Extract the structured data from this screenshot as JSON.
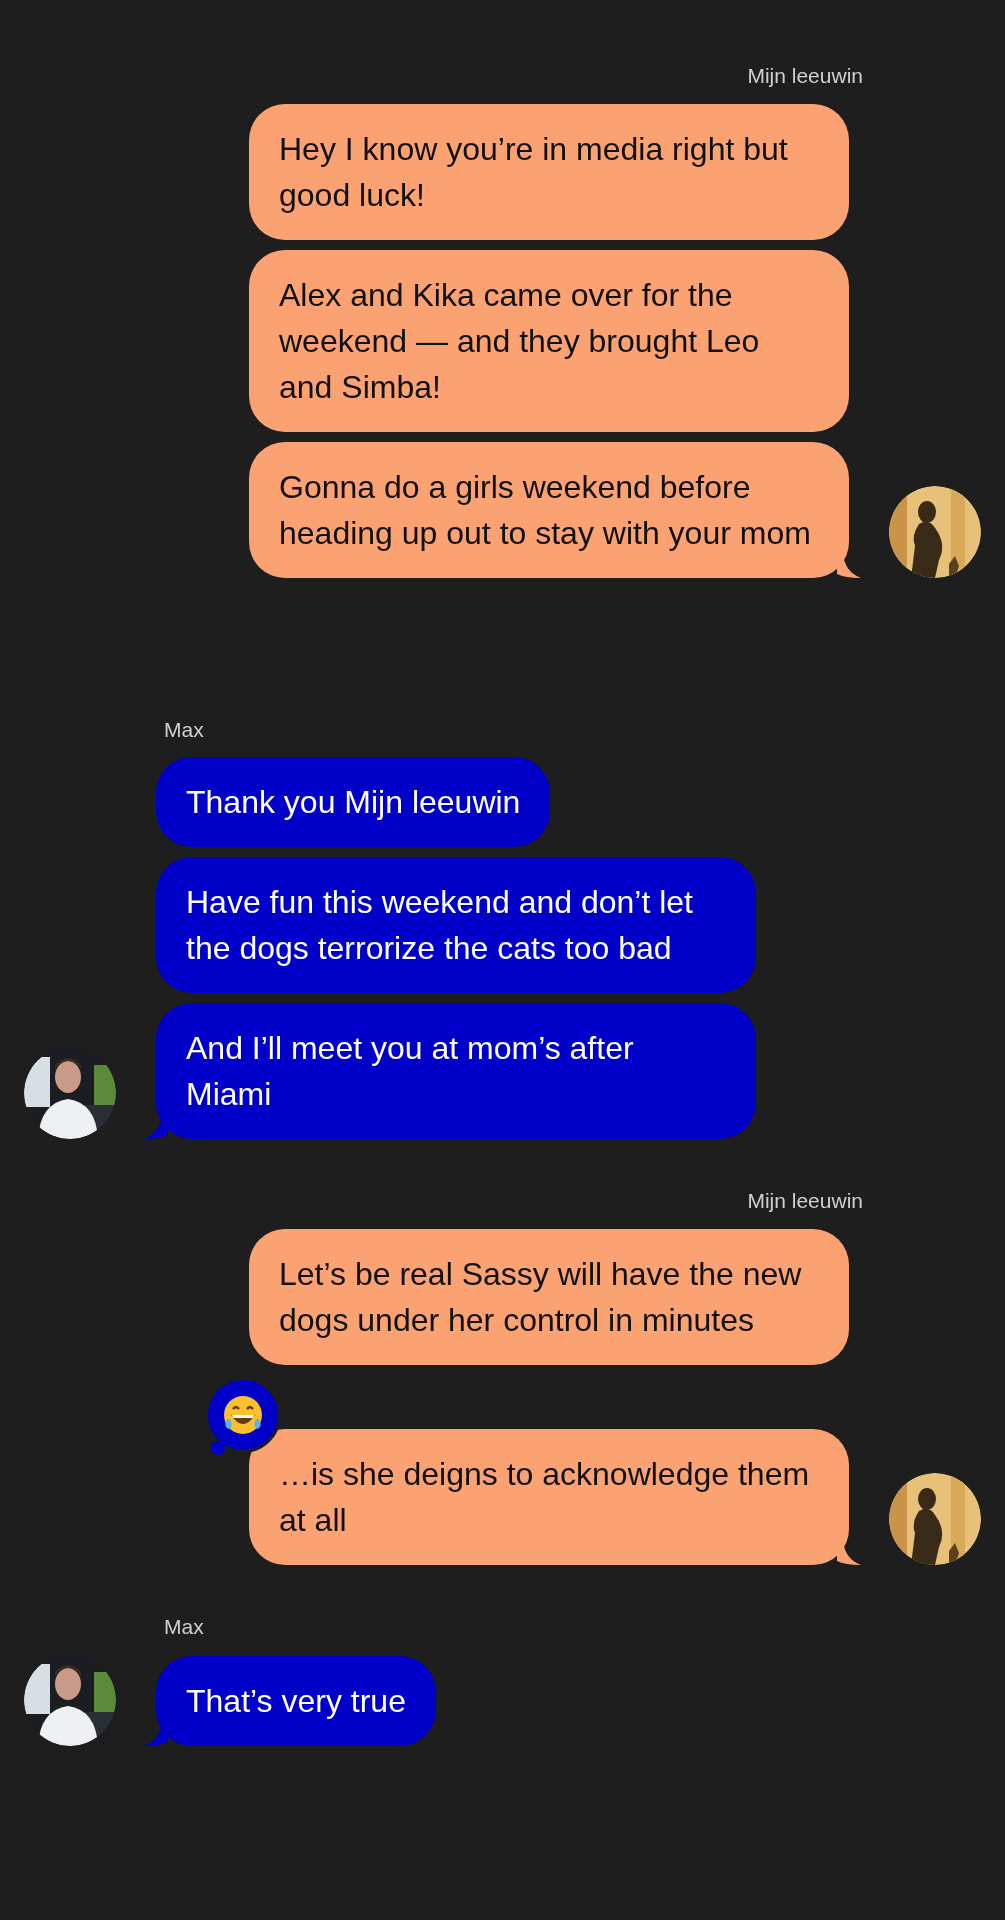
{
  "groups": [
    {
      "sender": "Mijn leeuwin",
      "kind": "outgoing",
      "messages": [
        {
          "text": "Hey I know you’re in media right but good luck!",
          "reacted": false
        },
        {
          "text": "Alex and Kika came over for the weekend — and they brought Leo and Simba!",
          "reacted": false
        },
        {
          "text": "Gonna do a girls weekend before heading up out to stay with your mom",
          "reacted": false
        }
      ]
    },
    {
      "sender": "Max",
      "kind": "incoming",
      "messages": [
        {
          "text": "Thank you Mijn leeuwin",
          "reacted": false
        },
        {
          "text": "Have fun this weekend and don’t let the dogs terrorize the cats too bad",
          "reacted": false
        },
        {
          "text": "And I’ll meet you at mom’s after Miami",
          "reacted": false
        }
      ]
    },
    {
      "sender": "Mijn leeuwin",
      "kind": "outgoing",
      "messages": [
        {
          "text": "Let’s be real Sassy will have the new dogs under her control in minutes",
          "reacted": false
        },
        {
          "text": "…is she deigns to acknowledge them at all",
          "reacted": true
        }
      ]
    },
    {
      "sender": "Max",
      "kind": "incoming",
      "messages": [
        {
          "text": "That’s very true",
          "reacted": false
        }
      ]
    }
  ]
}
